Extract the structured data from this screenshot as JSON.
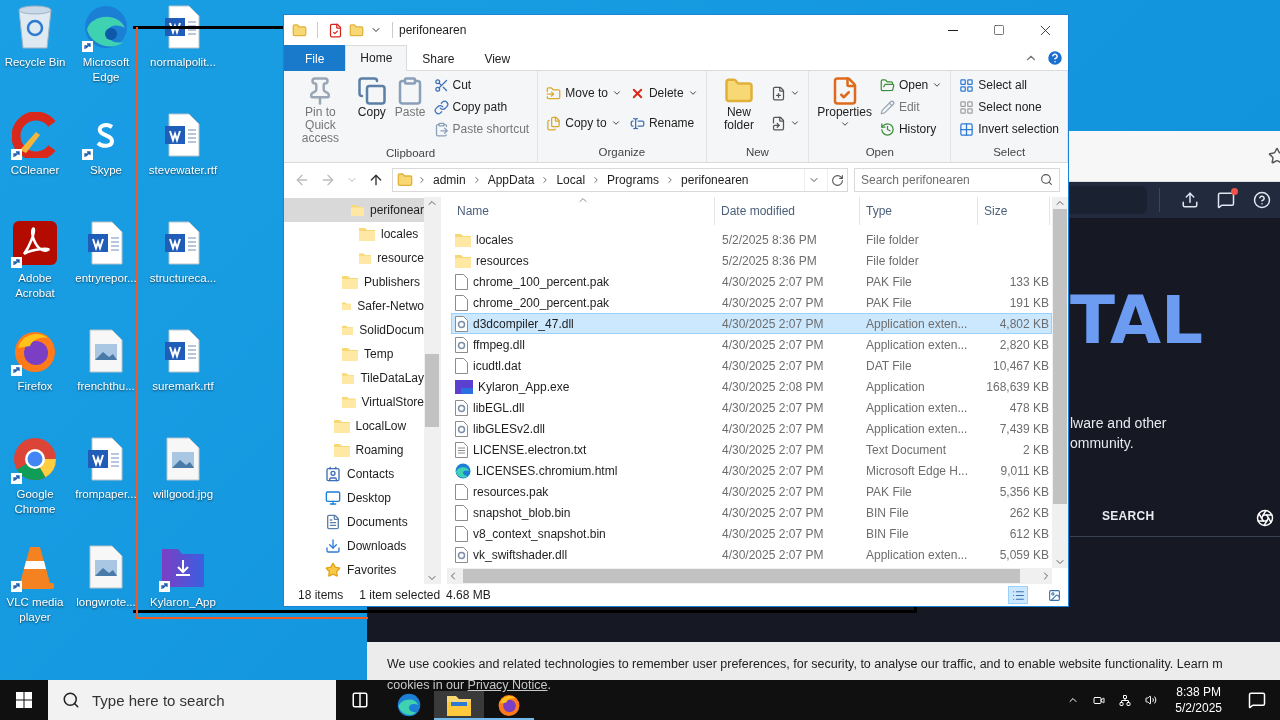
{
  "desktop_icons": [
    {
      "label": "Recycle Bin",
      "kind": "recycle",
      "shortcut": false
    },
    {
      "label": "CCleaner",
      "kind": "ccleaner",
      "shortcut": true
    },
    {
      "label": "Adobe Acrobat",
      "kind": "acrobat",
      "shortcut": true
    },
    {
      "label": "Firefox",
      "kind": "firefox",
      "shortcut": true
    },
    {
      "label": "Google Chrome",
      "kind": "chrome",
      "shortcut": true
    },
    {
      "label": "VLC media player",
      "kind": "vlc",
      "shortcut": true
    },
    {
      "label": "Microsoft Edge",
      "kind": "edge",
      "shortcut": true
    },
    {
      "label": "Skype",
      "kind": "skype",
      "shortcut": true
    },
    {
      "label": "entryrepor...",
      "kind": "word",
      "shortcut": false
    },
    {
      "label": "frenchthu...",
      "kind": "image",
      "shortcut": false
    },
    {
      "label": "frompaper...",
      "kind": "word",
      "shortcut": false
    },
    {
      "label": "longwrote...",
      "kind": "image",
      "shortcut": false
    },
    {
      "label": "normalpolit...",
      "kind": "word",
      "shortcut": false
    },
    {
      "label": "stevewater.rtf",
      "kind": "word",
      "shortcut": false
    },
    {
      "label": "structureca...",
      "kind": "word",
      "shortcut": false
    },
    {
      "label": "suremark.rtf",
      "kind": "word",
      "shortcut": false
    },
    {
      "label": "willgood.jpg",
      "kind": "image",
      "shortcut": false
    },
    {
      "label": "Kylaron_App",
      "kind": "kylaron",
      "shortcut": true
    }
  ],
  "browser": {
    "hero_title": "TAL",
    "hero_lines": [
      "lware and other",
      "ommunity."
    ],
    "nav_link": "SEARCH",
    "unread": true,
    "cookie_line": "We use cookies and related technologies to remember user preferences, for security, to analyse our traffic, and to enable website functionality. Learn m",
    "cookie_line_2": "cookies in our ",
    "privacy_link": "Privacy Notice",
    "cookie_end": "."
  },
  "explorer": {
    "title": "perifonearen",
    "ribbon_tabs": [
      {
        "label": "File",
        "kind": "file",
        "selected": false
      },
      {
        "label": "Home",
        "kind": "tab",
        "selected": true
      },
      {
        "label": "Share",
        "kind": "tab",
        "selected": false
      },
      {
        "label": "View",
        "kind": "tab",
        "selected": false
      }
    ],
    "ribbon_groups": [
      {
        "title": "Clipboard",
        "compact": false,
        "items": [
          {
            "kind": "large",
            "label": "Pin to Quick access",
            "disabled": true,
            "dropdown": false
          },
          {
            "kind": "large",
            "label": "Copy",
            "disabled": false,
            "dropdown": false
          },
          {
            "kind": "large",
            "label": "Paste",
            "disabled": true,
            "dropdown": false
          },
          {
            "kind": "small",
            "label": "Cut",
            "disabled": false,
            "dropdown": false
          },
          {
            "kind": "small",
            "label": "Copy path",
            "disabled": false,
            "dropdown": false
          },
          {
            "kind": "small",
            "label": "Paste shortcut",
            "disabled": true,
            "dropdown": false
          }
        ]
      },
      {
        "title": "Organize",
        "compact": true,
        "items": [
          {
            "kind": "small",
            "label": "Move to",
            "disabled": false,
            "dropdown": true
          },
          {
            "kind": "small",
            "label": "Copy to",
            "disabled": false,
            "dropdown": true
          },
          {
            "kind": "small",
            "label": "Delete",
            "disabled": false,
            "dropdown": true
          },
          {
            "kind": "small",
            "label": "Rename",
            "disabled": false,
            "dropdown": false
          }
        ]
      },
      {
        "title": "New",
        "compact": true,
        "items": [
          {
            "kind": "large",
            "label": "New folder",
            "disabled": false,
            "dropdown": false
          },
          {
            "kind": "small",
            "disabled": false,
            "dropdown": true
          },
          {
            "kind": "small",
            "disabled": false,
            "dropdown": true
          }
        ]
      },
      {
        "title": "Open",
        "compact": false,
        "items": [
          {
            "kind": "large",
            "label": "Properties",
            "disabled": false,
            "dropdown": true
          },
          {
            "kind": "small",
            "label": "Open",
            "disabled": false,
            "dropdown": true
          },
          {
            "kind": "small",
            "label": "Edit",
            "disabled": true,
            "dropdown": false
          },
          {
            "kind": "small",
            "label": "History",
            "disabled": false,
            "dropdown": false
          }
        ]
      },
      {
        "title": "Select",
        "compact": false,
        "items": [
          {
            "kind": "small",
            "label": "Select all",
            "disabled": false,
            "dropdown": false
          },
          {
            "kind": "small",
            "label": "Select none",
            "disabled": false,
            "dropdown": false
          },
          {
            "kind": "small",
            "label": "Invert selection",
            "disabled": false,
            "dropdown": false
          }
        ]
      }
    ],
    "path": [
      "admin",
      "AppData",
      "Local",
      "Programs",
      "perifonearen"
    ],
    "search_placeholder": "Search perifonearen",
    "nav_tree": [
      {
        "children": [
          {
            "children": [
              {
                "children": [
                  {
                    "label": "perifonear",
                    "kind": "folder",
                    "selected": true,
                    "children": [
                      {
                        "label": "locales",
                        "kind": "folder",
                        "selected": false
                      },
                      {
                        "label": "resource",
                        "kind": "folder",
                        "selected": false
                      }
                    ]
                  }
                ]
              },
              {
                "label": "Publishers",
                "kind": "folder",
                "selected": false
              },
              {
                "label": "Safer-Netwo",
                "kind": "folder",
                "selected": false
              },
              {
                "label": "SolidDocum",
                "kind": "folder",
                "selected": false
              },
              {
                "label": "Temp",
                "kind": "folder",
                "selected": false
              },
              {
                "label": "TileDataLay",
                "kind": "folder",
                "selected": false
              },
              {
                "label": "VirtualStore",
                "kind": "folder",
                "selected": false
              }
            ]
          },
          {
            "label": "LocalLow",
            "kind": "folder",
            "selected": false
          },
          {
            "label": "Roaming",
            "kind": "folder",
            "selected": false
          }
        ]
      },
      {
        "label": "Contacts",
        "kind": "contacts",
        "selected": false
      },
      {
        "label": "Desktop",
        "kind": "desktop",
        "selected": false
      },
      {
        "label": "Documents",
        "kind": "documents",
        "selected": false
      },
      {
        "label": "Downloads",
        "kind": "downloads",
        "selected": false
      },
      {
        "label": "Favorites",
        "kind": "favorites",
        "selected": false
      }
    ],
    "columns": [
      {
        "label": "Name",
        "sorted": true
      },
      {
        "label": "Date modified",
        "sorted": false
      },
      {
        "label": "Type",
        "sorted": false
      },
      {
        "label": "Size",
        "sorted": false
      }
    ],
    "files": [
      {
        "name": "locales",
        "date": "5/2/2025 8:36 PM",
        "type": "File folder",
        "kind": "folder",
        "selected": false
      },
      {
        "name": "resources",
        "date": "5/2/2025 8:36 PM",
        "type": "File folder",
        "kind": "folder",
        "selected": false
      },
      {
        "name": "chrome_100_percent.pak",
        "date": "4/30/2025 2:07 PM",
        "type": "PAK File",
        "size": "133 KB",
        "kind": "file",
        "selected": false
      },
      {
        "name": "chrome_200_percent.pak",
        "date": "4/30/2025 2:07 PM",
        "type": "PAK File",
        "size": "191 KB",
        "kind": "file",
        "selected": false
      },
      {
        "name": "d3dcompiler_47.dll",
        "date": "4/30/2025 2:07 PM",
        "type": "Application exten...",
        "size": "4,802 KB",
        "kind": "dll",
        "selected": true
      },
      {
        "name": "ffmpeg.dll",
        "date": "4/30/2025 2:07 PM",
        "type": "Application exten...",
        "size": "2,820 KB",
        "kind": "dll",
        "selected": false
      },
      {
        "name": "icudtl.dat",
        "date": "4/30/2025 2:07 PM",
        "type": "DAT File",
        "size": "10,467 KB",
        "kind": "file",
        "selected": false
      },
      {
        "name": "Kylaron_App.exe",
        "date": "4/30/2025 2:08 PM",
        "type": "Application",
        "size": "168,639 KB",
        "kind": "exe",
        "selected": false
      },
      {
        "name": "libEGL.dll",
        "date": "4/30/2025 2:07 PM",
        "type": "Application exten...",
        "size": "478 KB",
        "kind": "dll",
        "selected": false
      },
      {
        "name": "libGLESv2.dll",
        "date": "4/30/2025 2:07 PM",
        "type": "Application exten...",
        "size": "7,439 KB",
        "kind": "dll",
        "selected": false
      },
      {
        "name": "LICENSE.electron.txt",
        "date": "4/30/2025 2:07 PM",
        "type": "Text Document",
        "size": "2 KB",
        "kind": "text",
        "selected": false
      },
      {
        "name": "LICENSES.chromium.html",
        "date": "4/30/2025 2:07 PM",
        "type": "Microsoft Edge H...",
        "size": "9,011 KB",
        "kind": "edge",
        "selected": false
      },
      {
        "name": "resources.pak",
        "date": "4/30/2025 2:07 PM",
        "type": "PAK File",
        "size": "5,356 KB",
        "kind": "file",
        "selected": false
      },
      {
        "name": "snapshot_blob.bin",
        "date": "4/30/2025 2:07 PM",
        "type": "BIN File",
        "size": "262 KB",
        "kind": "file",
        "selected": false
      },
      {
        "name": "v8_context_snapshot.bin",
        "date": "4/30/2025 2:07 PM",
        "type": "BIN File",
        "size": "612 KB",
        "kind": "file",
        "selected": false
      },
      {
        "name": "vk_swiftshader.dll",
        "date": "4/30/2025 2:07 PM",
        "type": "Application exten...",
        "size": "5,059 KB",
        "kind": "dll",
        "selected": false
      }
    ],
    "status": {
      "count": "18 items",
      "selection": "1 item selected",
      "size": "4.68 MB"
    },
    "views": [
      {
        "kind": "details",
        "selected": true
      },
      {
        "kind": "large",
        "selected": false
      }
    ]
  },
  "taskbar": {
    "search_placeholder": "Type here to search",
    "apps": [
      {
        "kind": "edge",
        "open": false,
        "active": false
      },
      {
        "kind": "explorer",
        "open": true,
        "active": true
      },
      {
        "kind": "firefox",
        "open": true,
        "active": false
      }
    ],
    "time": "8:38 PM",
    "date": "5/2/2025"
  }
}
